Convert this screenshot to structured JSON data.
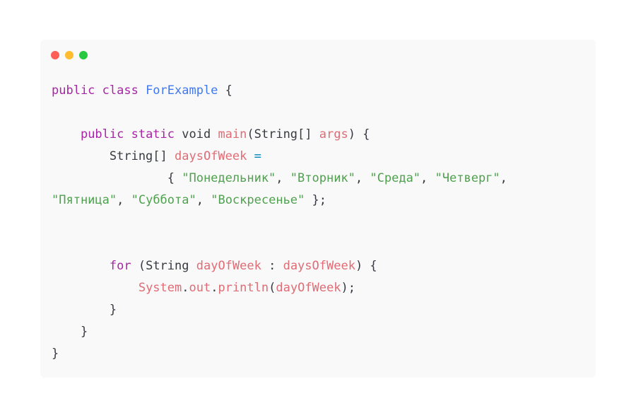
{
  "window": {
    "controls": [
      "close",
      "minimize",
      "maximize"
    ],
    "control_colors": {
      "close": "#fe5f57",
      "minimize": "#febc2e",
      "maximize": "#28c840"
    },
    "background": "#f9f9f9"
  },
  "code": {
    "language": "java",
    "lines": [
      [
        {
          "t": "public class ",
          "c": "kw"
        },
        {
          "t": "ForExample",
          "c": "cls"
        },
        {
          "t": " {",
          "c": "plain"
        }
      ],
      [],
      [
        {
          "t": "    ",
          "c": "plain"
        },
        {
          "t": "public static ",
          "c": "kw"
        },
        {
          "t": "void ",
          "c": "plain"
        },
        {
          "t": "main",
          "c": "var"
        },
        {
          "t": "(String[] ",
          "c": "plain"
        },
        {
          "t": "args",
          "c": "var"
        },
        {
          "t": ") {",
          "c": "plain"
        }
      ],
      [
        {
          "t": "        String[] ",
          "c": "plain"
        },
        {
          "t": "daysOfWeek",
          "c": "var"
        },
        {
          "t": " =",
          "c": "op"
        }
      ],
      [
        {
          "t": "                { ",
          "c": "plain"
        },
        {
          "t": "\"Понедельник\"",
          "c": "str"
        },
        {
          "t": ", ",
          "c": "plain"
        },
        {
          "t": "\"Вторник\"",
          "c": "str"
        },
        {
          "t": ", ",
          "c": "plain"
        },
        {
          "t": "\"Среда\"",
          "c": "str"
        },
        {
          "t": ", ",
          "c": "plain"
        },
        {
          "t": "\"Четверг\"",
          "c": "str"
        },
        {
          "t": ",",
          "c": "plain"
        }
      ],
      [
        {
          "t": "\"Пятница\"",
          "c": "str"
        },
        {
          "t": ", ",
          "c": "plain"
        },
        {
          "t": "\"Суббота\"",
          "c": "str"
        },
        {
          "t": ", ",
          "c": "plain"
        },
        {
          "t": "\"Воскресенье\"",
          "c": "str"
        },
        {
          "t": " };",
          "c": "plain"
        }
      ],
      [],
      [],
      [
        {
          "t": "        ",
          "c": "plain"
        },
        {
          "t": "for",
          "c": "kw"
        },
        {
          "t": " (String ",
          "c": "plain"
        },
        {
          "t": "dayOfWeek",
          "c": "var"
        },
        {
          "t": " : ",
          "c": "plain"
        },
        {
          "t": "daysOfWeek",
          "c": "var"
        },
        {
          "t": ") {",
          "c": "plain"
        }
      ],
      [
        {
          "t": "            ",
          "c": "plain"
        },
        {
          "t": "System",
          "c": "var"
        },
        {
          "t": ".",
          "c": "plain"
        },
        {
          "t": "out",
          "c": "var"
        },
        {
          "t": ".",
          "c": "plain"
        },
        {
          "t": "println",
          "c": "var"
        },
        {
          "t": "(",
          "c": "plain"
        },
        {
          "t": "dayOfWeek",
          "c": "var"
        },
        {
          "t": ");",
          "c": "plain"
        }
      ],
      [
        {
          "t": "        }",
          "c": "plain"
        }
      ],
      [
        {
          "t": "    }",
          "c": "plain"
        }
      ],
      [
        {
          "t": "}",
          "c": "plain"
        }
      ]
    ]
  }
}
